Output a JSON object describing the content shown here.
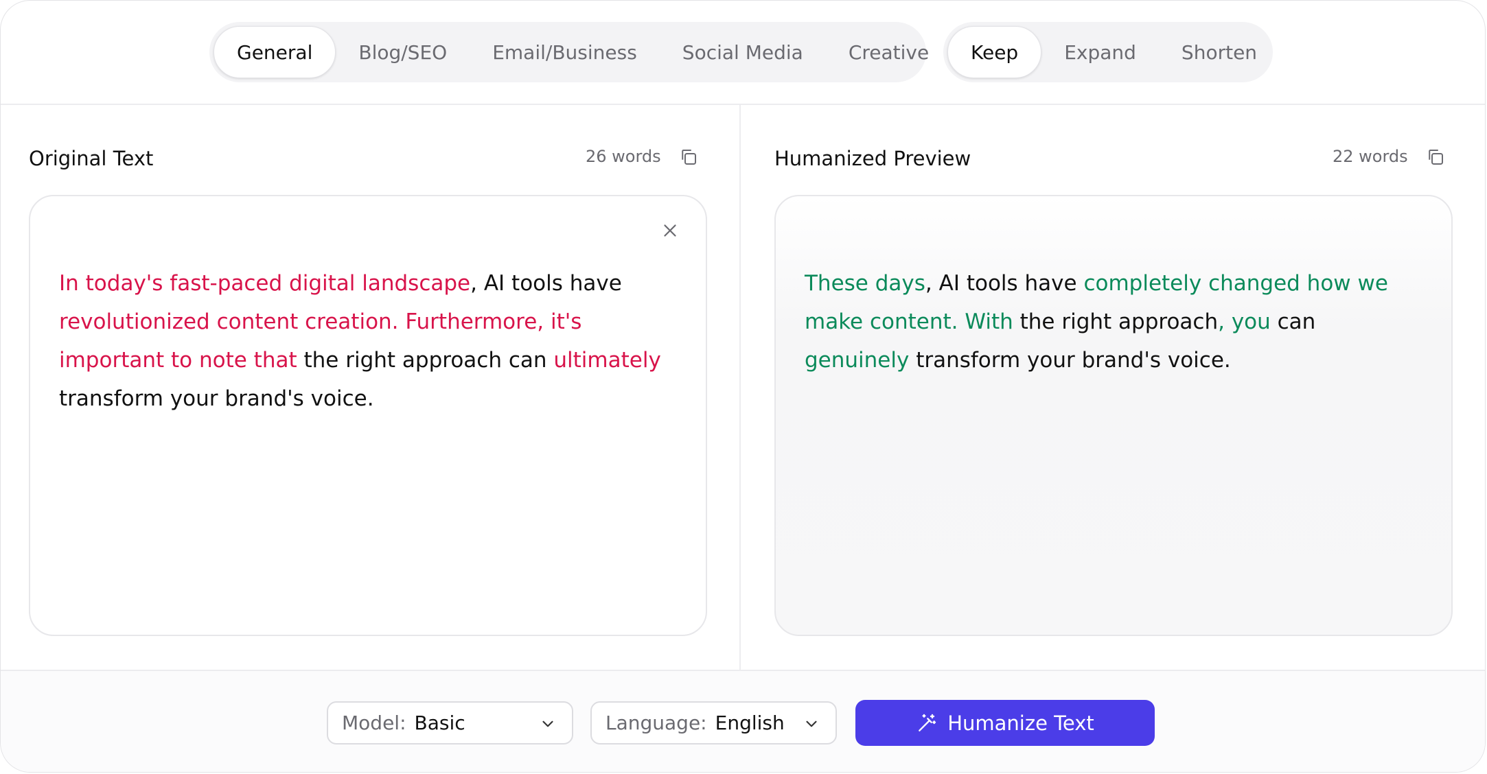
{
  "style_tabs": [
    {
      "label": "General",
      "active": true
    },
    {
      "label": "Blog/SEO",
      "active": false
    },
    {
      "label": "Email/Business",
      "active": false
    },
    {
      "label": "Social Media",
      "active": false
    },
    {
      "label": "Creative",
      "active": false
    }
  ],
  "length_tabs": [
    {
      "label": "Keep",
      "active": true
    },
    {
      "label": "Expand",
      "active": false
    },
    {
      "label": "Shorten",
      "active": false
    }
  ],
  "original": {
    "title": "Original Text",
    "word_count": "26 words",
    "segments": [
      {
        "text": "In today's fast-paced digital landscape",
        "type": "removed"
      },
      {
        "text": ", AI tools have ",
        "type": "kept"
      },
      {
        "text": "revolutionized content creation. Furthermore, it's important to note that",
        "type": "removed"
      },
      {
        "text": " the right approach can ",
        "type": "kept"
      },
      {
        "text": "ultimately",
        "type": "removed"
      },
      {
        "text": " transform your brand's voice.",
        "type": "kept"
      }
    ]
  },
  "humanized": {
    "title": "Humanized Preview",
    "word_count": "22 words",
    "segments": [
      {
        "text": "These days",
        "type": "added"
      },
      {
        "text": ", AI tools have ",
        "type": "kept"
      },
      {
        "text": "completely changed how we make content. With",
        "type": "added"
      },
      {
        "text": " the right approach",
        "type": "kept"
      },
      {
        "text": ", you",
        "type": "added"
      },
      {
        "text": " can ",
        "type": "kept"
      },
      {
        "text": "genuinely",
        "type": "added"
      },
      {
        "text": " transform your brand's voice.",
        "type": "kept"
      }
    ]
  },
  "controls": {
    "model_label": "Model:",
    "model_value": "Basic",
    "language_label": "Language:",
    "language_value": "English",
    "humanize_button": "Humanize Text"
  },
  "colors": {
    "accent": "#4b3de8",
    "removed": "#d8134a",
    "added": "#0b8a5a"
  },
  "icons": {
    "copy": "copy-icon",
    "close": "close-icon",
    "chevron": "chevron-down-icon",
    "wand": "magic-wand-icon"
  }
}
